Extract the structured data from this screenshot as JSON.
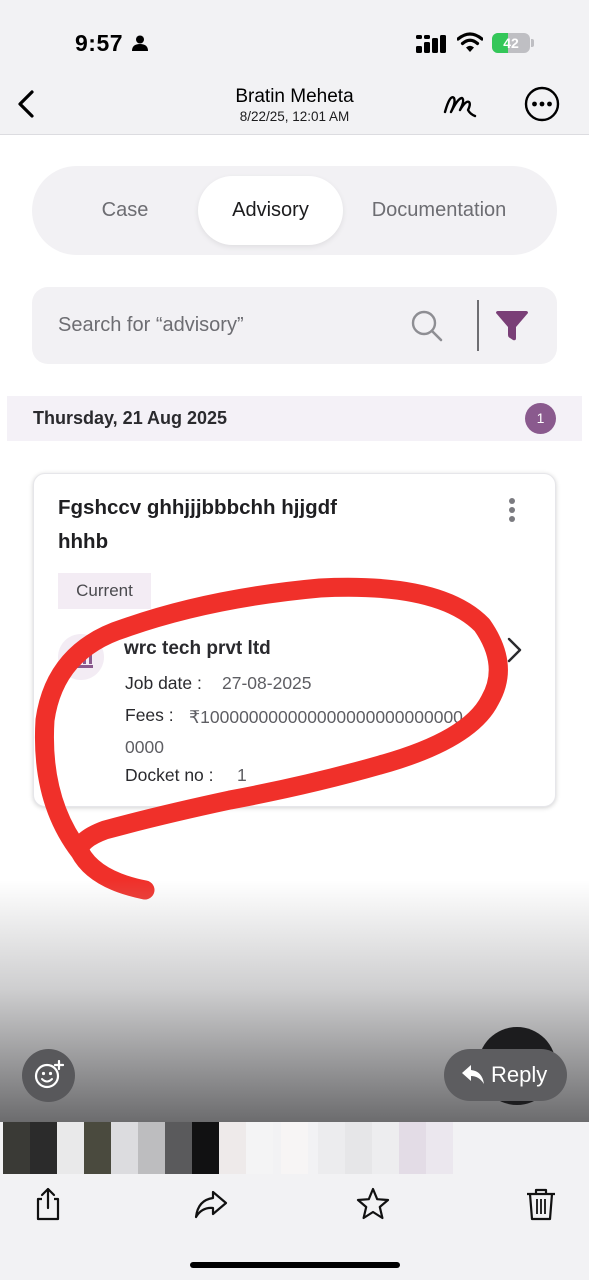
{
  "status_bar": {
    "time": "9:57",
    "battery": "42",
    "battery_level": 0.42
  },
  "header": {
    "title": "Bratin Meheta",
    "subtitle": "8/22/25, 12:01 AM"
  },
  "tabs": {
    "case": "Case",
    "advisory": "Advisory",
    "documentation": "Documentation",
    "active": "advisory"
  },
  "search": {
    "placeholder": "Search for “advisory”"
  },
  "group": {
    "date": "Thursday, 21 Aug  2025",
    "count": "1"
  },
  "card": {
    "title": "Fgshccv ghhjjjbbbchh hjjgdf hhhb",
    "status": "Current",
    "company": "wrc tech prvt ltd",
    "job_date_label": "Job date :",
    "job_date": "27-08-2025",
    "fees_label": "Fees :",
    "fees_value": "₹1000000000000000000000000000000",
    "docket_label": "Docket no :",
    "docket_no": "1"
  },
  "overlay": {
    "reply": "Reply"
  },
  "colors": {
    "accent": "#8a5a8e",
    "annotation": "#f0302a",
    "chip_bg": "#f3ecf4"
  },
  "icons": [
    "person-icon",
    "signal-icon",
    "wifi-icon",
    "back-icon",
    "markup-icon",
    "more-icon",
    "search-icon",
    "filter-icon",
    "kebab-icon",
    "bank-icon",
    "chevron-right-icon",
    "add-reaction-icon",
    "reply-icon",
    "share-icon",
    "forward-icon",
    "star-icon",
    "trash-icon"
  ]
}
